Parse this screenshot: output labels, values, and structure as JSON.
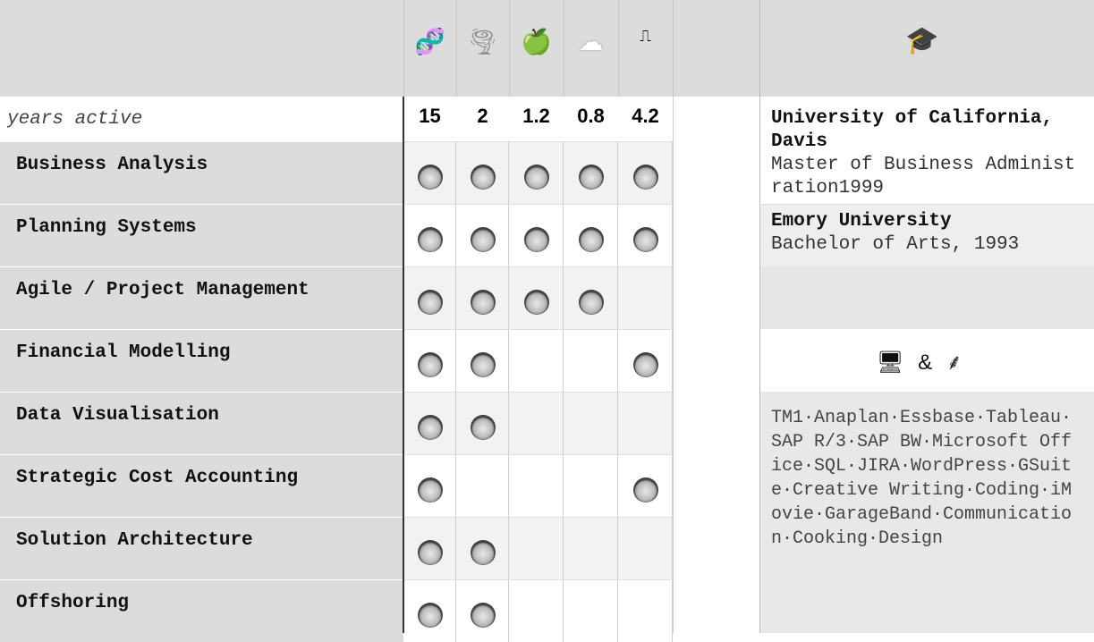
{
  "header_icons": [
    {
      "name": "dna-icon",
      "glyph": "🧬",
      "color": "#c040c0"
    },
    {
      "name": "tornado-icon",
      "glyph": "🌪",
      "color": "#888888"
    },
    {
      "name": "apple-icon",
      "glyph": "🍏",
      "color": "#39a020"
    },
    {
      "name": "cloud-icon",
      "glyph": "☁",
      "color": "#ffffff"
    },
    {
      "name": "signal-icon",
      "glyph": "⎍",
      "color": "#000000"
    }
  ],
  "education_icon": "🎓",
  "years_label": "years active",
  "years": [
    "15",
    "2",
    "1.2",
    "0.8",
    "4.2"
  ],
  "skills": [
    {
      "label": "Business Analysis",
      "marks": [
        true,
        true,
        true,
        true,
        true
      ]
    },
    {
      "label": "Planning Systems",
      "marks": [
        true,
        true,
        true,
        true,
        true
      ]
    },
    {
      "label": "Agile / Project Management",
      "marks": [
        true,
        true,
        true,
        true,
        false
      ]
    },
    {
      "label": "Financial Modelling",
      "marks": [
        true,
        true,
        false,
        false,
        true
      ]
    },
    {
      "label": "Data Visualisation",
      "marks": [
        true,
        true,
        false,
        false,
        false
      ]
    },
    {
      "label": "Strategic Cost Accounting",
      "marks": [
        true,
        false,
        false,
        false,
        true
      ]
    },
    {
      "label": "Solution Architecture",
      "marks": [
        true,
        true,
        false,
        false,
        false
      ]
    },
    {
      "label": "Offshoring",
      "marks": [
        true,
        true,
        false,
        false,
        false
      ]
    }
  ],
  "education": [
    {
      "school": "University of California, Davis",
      "degree": "Master of Business Administration1999"
    },
    {
      "school": "Emory University",
      "degree": "Bachelor of Arts, 1993"
    }
  ],
  "tools_heading": {
    "computer_icon": "🖥",
    "amp": "&",
    "doc_icon": "⸙"
  },
  "tools_text": "TM1·Anaplan·Essbase·Tableau·SAP R/3·SAP BW·Microsoft Office·SQL·JIRA·WordPress·GSuite·Creative Writing·Coding·iMovie·GarageBand·Communication·Cooking·Design"
}
